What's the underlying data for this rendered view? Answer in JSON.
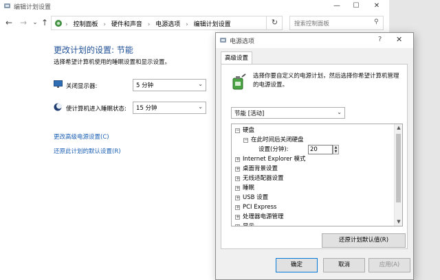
{
  "main_window": {
    "title": "编辑计划设置",
    "controls": {
      "minimize": "—",
      "maximize": "☐",
      "close": "✕"
    },
    "nav": {
      "back": "←",
      "forward": "→",
      "dropdown": "⌄",
      "up": "↑"
    },
    "breadcrumbs": [
      "控制面板",
      "硬件和声音",
      "电源选项",
      "编辑计划设置"
    ],
    "breadcrumb_separator": "›",
    "refresh": "↻",
    "search_placeholder": "搜索控制面板",
    "page_title": "更改计划的设置: 节能",
    "page_desc": "选择希望计算机使用的睡眠设置和显示设置。",
    "settings": [
      {
        "label": "关闭显示器:",
        "value": "5 分钟",
        "icon": "monitor-icon"
      },
      {
        "label": "使计算机进入睡眠状态:",
        "value": "15 分钟",
        "icon": "moon-icon"
      }
    ],
    "links": {
      "advanced": "更改高级电源设置(C)",
      "restore": "还原此计划的默认设置(R)"
    }
  },
  "dialog": {
    "title": "电源选项",
    "help": "?",
    "close": "✕",
    "tab": "高级设置",
    "description": "选择你要自定义的电源计划，然后选择你希望计算机管理的电源设置。",
    "plan_selected": "节能 [活动]",
    "tree": {
      "hard_disk": "硬盘",
      "turn_off_after": "在此时间后关闭硬盘",
      "setting_label": "设置(分钟):",
      "setting_value": "20",
      "items": [
        "Internet Explorer 模式",
        "桌面背景设置",
        "无线适配器设置",
        "睡眠",
        "USB 设置",
        "PCI Express",
        "处理器电源管理",
        "显示"
      ]
    },
    "restore_button": "还原计划默认值(R)",
    "buttons": {
      "ok": "确定",
      "cancel": "取消",
      "apply": "应用(A)"
    }
  },
  "colors": {
    "title_blue": "#1e4f96",
    "link_blue": "#1a5fb4",
    "ok_border": "#0078d7",
    "disabled_text": "#8c8c8c"
  }
}
